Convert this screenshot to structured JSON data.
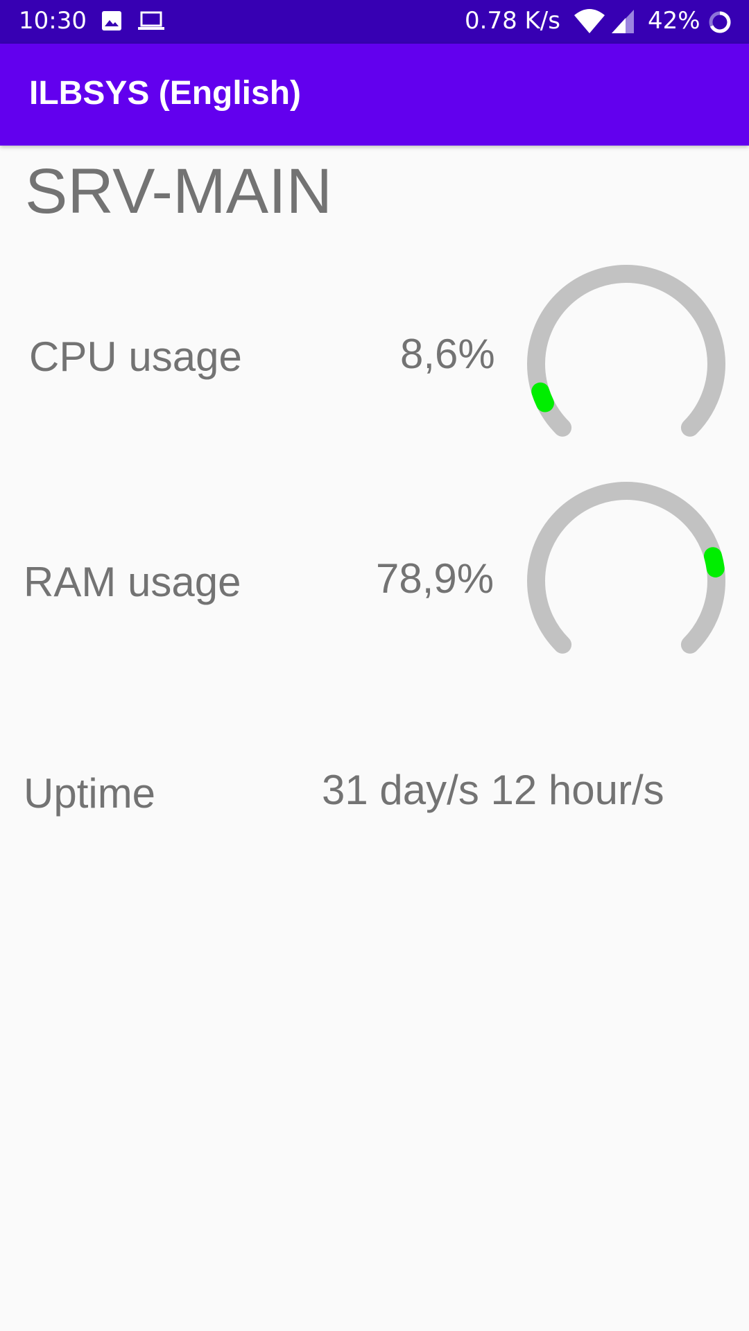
{
  "status_bar": {
    "time": "10:30",
    "net_speed": "0.78 K/s",
    "battery": "42%",
    "icons": [
      "image-icon",
      "laptop-icon",
      "wifi-icon",
      "signal-icon",
      "battery-icon"
    ]
  },
  "app_bar": {
    "title": "ILBSYS (English)"
  },
  "server": {
    "name": "SRV-MAIN"
  },
  "metrics": {
    "cpu": {
      "label": "CPU usage",
      "value_text": "8,6%",
      "percent": 8.6
    },
    "ram": {
      "label": "RAM usage",
      "value_text": "78,9%",
      "percent": 78.9
    },
    "uptime": {
      "label": "Uptime",
      "value_text": "31 day/s 12 hour/s"
    }
  },
  "colors": {
    "status_bar": "#3700b3",
    "app_bar": "#6200ee",
    "gauge_track": "#c2c2c2",
    "gauge_indicator": "#00ee00",
    "text": "#737373"
  }
}
